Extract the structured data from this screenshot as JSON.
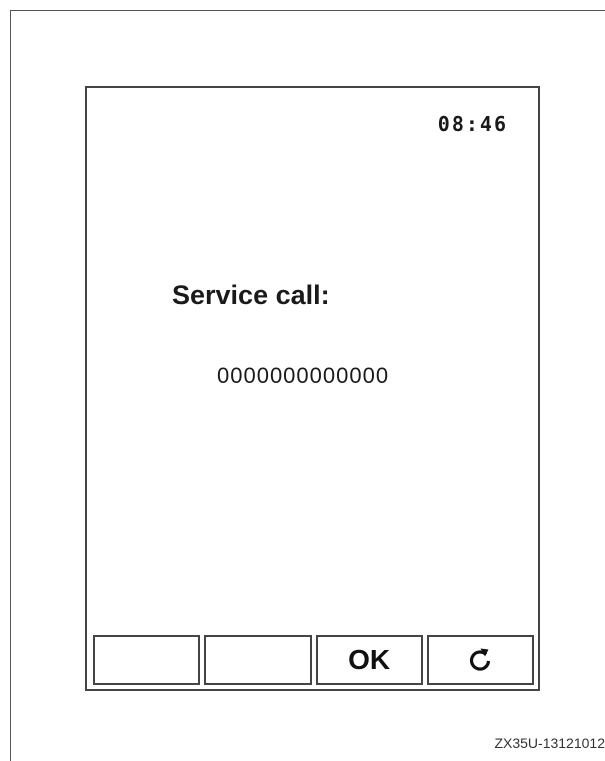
{
  "screen": {
    "clock": "08:46",
    "title": "Service call:",
    "phone_number": "0000000000000"
  },
  "softkeys": [
    {
      "label": ""
    },
    {
      "label": ""
    },
    {
      "label": "OK"
    },
    {
      "label": "",
      "icon": "refresh-icon"
    }
  ],
  "figure": {
    "caption": "ZX35U-13121012"
  }
}
